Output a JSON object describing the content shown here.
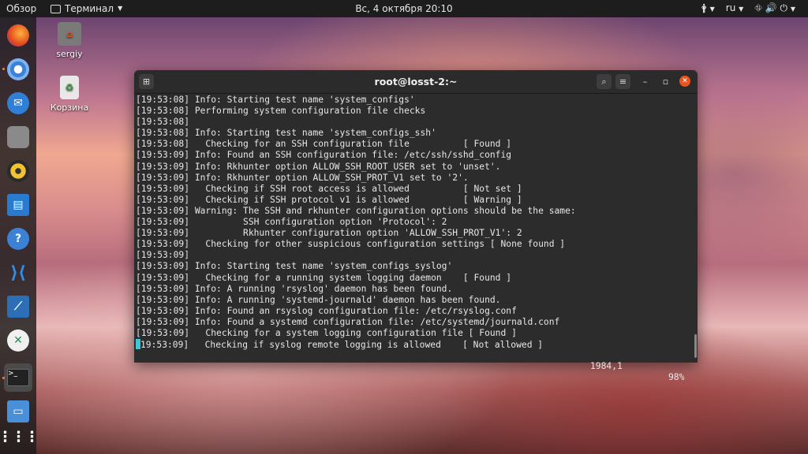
{
  "topbar": {
    "activities": "Обзор",
    "app_menu": "Терминал",
    "clock": "Вс, 4 октября  20:10",
    "language": "ru"
  },
  "desktop": {
    "home_label": "sergiy",
    "trash_label": "Корзина"
  },
  "terminal": {
    "title": "root@losst-2:~",
    "lines": [
      "[19:53:08] Info: Starting test name 'system_configs'",
      "[19:53:08] Performing system configuration file checks",
      "[19:53:08]",
      "[19:53:08] Info: Starting test name 'system_configs_ssh'",
      "[19:53:08]   Checking for an SSH configuration file          [ Found ]",
      "[19:53:09] Info: Found an SSH configuration file: /etc/ssh/sshd_config",
      "[19:53:09] Info: Rkhunter option ALLOW_SSH_ROOT_USER set to 'unset'.",
      "[19:53:09] Info: Rkhunter option ALLOW_SSH_PROT_V1 set to '2'.",
      "[19:53:09]   Checking if SSH root access is allowed          [ Not set ]",
      "[19:53:09]   Checking if SSH protocol v1 is allowed          [ Warning ]",
      "[19:53:09] Warning: The SSH and rkhunter configuration options should be the same:",
      "[19:53:09]          SSH configuration option 'Protocol': 2",
      "[19:53:09]          Rkhunter configuration option 'ALLOW_SSH_PROT_V1': 2",
      "[19:53:09]   Checking for other suspicious configuration settings [ None found ]",
      "[19:53:09]",
      "[19:53:09] Info: Starting test name 'system_configs_syslog'",
      "[19:53:09]   Checking for a running system logging daemon    [ Found ]",
      "[19:53:09] Info: A running 'rsyslog' daemon has been found.",
      "[19:53:09] Info: A running 'systemd-journald' daemon has been found.",
      "[19:53:09] Info: Found an rsyslog configuration file: /etc/rsyslog.conf",
      "[19:53:09] Info: Found a systemd configuration file: /etc/systemd/journald.conf",
      "[19:53:09]   Checking for a system logging configuration file [ Found ]"
    ],
    "last_line": "19:53:09]   Checking if syslog remote logging is allowed    [ Not allowed ]",
    "status_position": "1984,1",
    "status_percent": "98%"
  },
  "colors": {
    "cursor": "#3ec7d9",
    "close_button": "#e95420"
  },
  "icons": {
    "dock": [
      "firefox-icon",
      "chromium-icon",
      "thunderbird-icon",
      "files-icon",
      "rhythmbox-icon",
      "writer-icon",
      "help-icon",
      "vscode-icon",
      "system-monitor-icon",
      "network-icon",
      "terminal-icon",
      "screenshot-icon",
      "app-grid-icon"
    ]
  }
}
